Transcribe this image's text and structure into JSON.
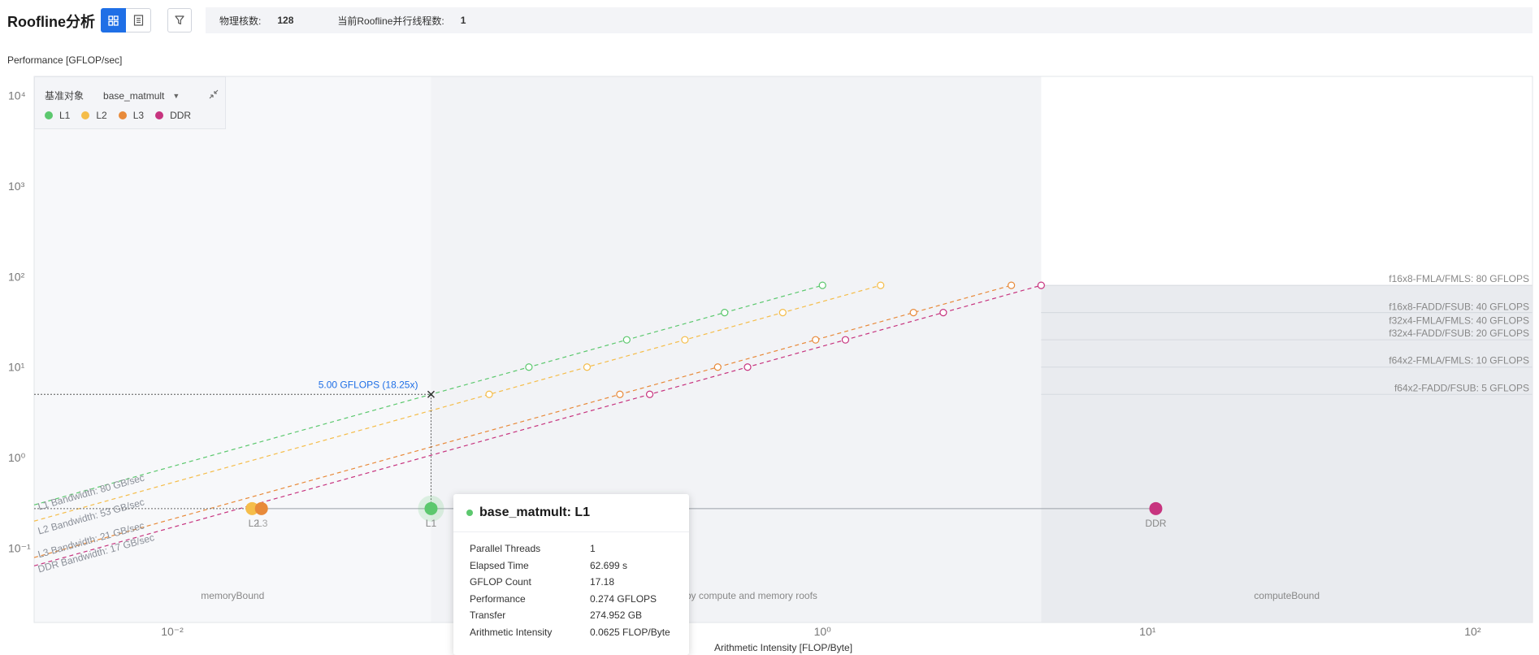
{
  "header": {
    "title": "Roofline分析",
    "cores_label": "物理核数:",
    "cores_value": "128",
    "threads_label": "当前Roofline并行线程数:",
    "threads_value": "1"
  },
  "icons": {
    "grid_view": "grid-icon",
    "list_view": "list-icon",
    "filter": "filter-icon",
    "collapse": "collapse-icon",
    "caret": "caret-down-icon"
  },
  "legend": {
    "ref_label": "基准对象",
    "ref_value": "base_matmult",
    "items": [
      {
        "name": "L1",
        "color": "#5cc86e"
      },
      {
        "name": "L2",
        "color": "#f5bd4a"
      },
      {
        "name": "L3",
        "color": "#e88a3a"
      },
      {
        "name": "DDR",
        "color": "#c7347f"
      }
    ]
  },
  "chart_data": {
    "type": "scatter",
    "title": "",
    "ylabel": "Performance [GFLOP/sec]",
    "xlabel": "Arithmetic Intensity [FLOP/Byte]",
    "xscale": "log",
    "yscale": "log",
    "xlim": [
      0.004,
      0.15
    ],
    "ylim": [
      0.0012,
      0.0035
    ],
    "x_ticks": [
      {
        "value": 0.01,
        "label": "10⁻²"
      },
      {
        "value": 1,
        "label": "10⁰"
      },
      {
        "value": 10,
        "label": "10¹"
      },
      {
        "value": 100,
        "label": "10²"
      }
    ],
    "y_ticks": [
      {
        "value": 10000,
        "label": "10⁴"
      },
      {
        "value": 1000,
        "label": "10³"
      },
      {
        "value": 100,
        "label": "10²"
      },
      {
        "value": 10,
        "label": "10¹"
      },
      {
        "value": 1,
        "label": "10⁰"
      },
      {
        "value": 0.1,
        "label": "10⁻¹"
      }
    ],
    "compute_roofs": [
      {
        "label": "f16x8-FMLA/FMLS: 80 GFLOPS",
        "value": 80
      },
      {
        "label": "f16x8-FADD/FSUB: 40 GFLOPS",
        "value": 40
      },
      {
        "label": "f32x4-FMLA/FMLS: 40 GFLOPS",
        "value": 40
      },
      {
        "label": "f32x4-FADD/FSUB: 20 GFLOPS",
        "value": 20
      },
      {
        "label": "f64x2-FMLA/FMLS: 10 GFLOPS",
        "value": 10
      },
      {
        "label": "f64x2-FADD/FSUB: 5 GFLOPS",
        "value": 5
      }
    ],
    "memory_roofs": [
      {
        "name": "L1",
        "label": "L1 Bandwidth: 80 GB/sec",
        "bandwidth": 80,
        "color": "#5cc86e"
      },
      {
        "name": "L2",
        "label": "L2 Bandwidth: 53 GB/sec",
        "bandwidth": 53,
        "color": "#f5bd4a"
      },
      {
        "name": "L3",
        "label": "L3 Bandwidth: 21 GB/sec",
        "bandwidth": 21,
        "color": "#e88a3a"
      },
      {
        "name": "DDR",
        "label": "DDR Bandwidth: 17 GB/sec",
        "bandwidth": 17,
        "color": "#c7347f"
      }
    ],
    "points": [
      {
        "label": "L2",
        "x": 0.0176,
        "y": 0.274,
        "color": "#f5bd4a"
      },
      {
        "label": "L3",
        "x": 0.0188,
        "y": 0.274,
        "color": "#e88a3a"
      },
      {
        "label": "L1",
        "x": 0.0625,
        "y": 0.274,
        "color": "#5cc86e"
      },
      {
        "label": "DDR",
        "x": 10.6,
        "y": 0.274,
        "color": "#c7347f"
      }
    ],
    "annotation": "5.00 GFLOPS (18.25x)",
    "regions": [
      "memoryBound",
      "Bound by compute and memory roofs",
      "computeBound"
    ],
    "legend_placement": "top-left"
  },
  "tooltip": {
    "title": "base_matmult: L1",
    "color": "#5cc86e",
    "rows": [
      {
        "key": "Parallel Threads",
        "value": "1"
      },
      {
        "key": "Elapsed Time",
        "value": "62.699 s"
      },
      {
        "key": "GFLOP Count",
        "value": "17.18"
      },
      {
        "key": "Performance",
        "value": "0.274 GFLOPS"
      },
      {
        "key": "Transfer",
        "value": "274.952 GB"
      },
      {
        "key": "Arithmetic Intensity",
        "value": "0.0625 FLOP/Byte"
      }
    ]
  }
}
